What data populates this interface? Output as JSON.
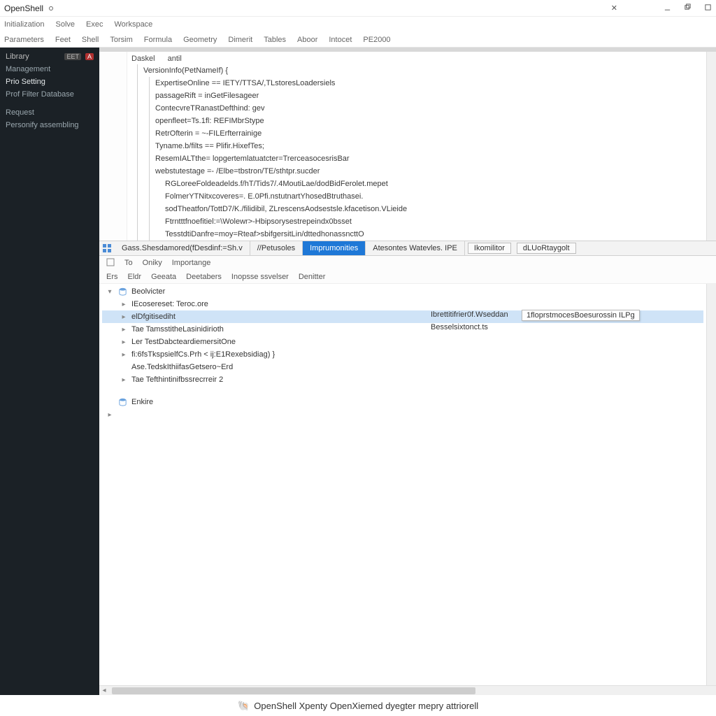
{
  "title": "OpenShell",
  "menus1": [
    "Initialization",
    "Solve",
    "Exec",
    "Workspace"
  ],
  "menus2": [
    "Parameters",
    "Feet",
    "Shell",
    "Torsim",
    "Formula",
    "Geometry",
    "Dimerit",
    "Tables",
    "Aboor",
    "Intocet",
    "PE2000"
  ],
  "sidebar": {
    "head": {
      "label": "Library",
      "tag1": "EET",
      "tag2": "A"
    },
    "items": [
      "Management",
      "Prio Setting",
      "Prof Filter Database",
      "Request",
      "Personify assembling"
    ]
  },
  "code": {
    "crumb1": "Daskel",
    "crumb2": "antil",
    "decl": "VersionInfo(PetNameIf) {",
    "lines": [
      "ExpertiseOnline == IETY/TTSA/,TLstoresLoadersiels",
      "passageRift = inGetFilesageer",
      "ContecvreTRanastDefthind: gev",
      "openfleet=Ts.1fl: REFIMbrStype",
      "RetrOfterin = ~-FILErfterrainige",
      "Tyname.b/filts == Plifir.HixefTes;",
      "ResemIALTthe= lopgertemlatuatcter=TrerceasocesrisBar",
      "webstutestage =- /Elbe=tbstron/TE/sthtpr.sucder",
      "RGLoreeFoldeadelds.f/hT/Tids7/.4MoutiLae/dodBidFerolet.mepet",
      "FolmerYTNitxcoveres=. E.0Pfi.nstutnartYhosedBtruthasei.",
      "sodTheatfon/TottD7/K./filidibil, ZLrescensAodsestsle.kfacetison.VLieide",
      "Ftrntttfnoefitiel:=\\Wolewr>-Hbipsorysestrepeindx0bsset",
      "TesstdtiDanfre=moy=Rteaf>sbifgersitLin/dttedhonassncttO"
    ]
  },
  "tabs": {
    "first": "Gass.Shesdamored(fDesdinf:=Sh.v",
    "items": [
      "//Petusoles",
      "Imprumonities",
      "Atesontes Watevles. IPE"
    ],
    "boxed": [
      "Ikomilitor",
      "dLUoRtaygolt"
    ],
    "activeIndex": 1
  },
  "subtool1": [
    "To",
    "Oniky",
    "Importange"
  ],
  "subtool2": [
    "Ers",
    "Eldr",
    "Geeata",
    "Deetabers",
    "Inopsse ssvelser",
    "Denitter"
  ],
  "tree": {
    "root": "Beolvicter",
    "rows": [
      {
        "label": "IEcosereset: Teroc.ore",
        "col2": ""
      },
      {
        "label": "elDfgitisediht",
        "col2": "Ibrettitifrier0f.Wseddan",
        "tooltip": "1floprstmocesBoesurossin ILPg",
        "selected": true
      },
      {
        "label": "Tae TamsstitheLasinidirioth",
        "col2": "Besselsixtonct.ts"
      },
      {
        "label": "Ler TestDabcteardiemersitOne"
      },
      {
        "label": "fi:6fsTkspsielfCs.Prh < ij:E1Rexebsidiag) }"
      },
      {
        "label": "Ase.TedskIthiifasGetsero~Erd"
      },
      {
        "label": "Tae Tefthintinifbssrecrreir  2"
      }
    ],
    "footer": "Enkire"
  },
  "footer": "OpenShell Xpenty OpenXiemed dyegter mepry attriorell"
}
